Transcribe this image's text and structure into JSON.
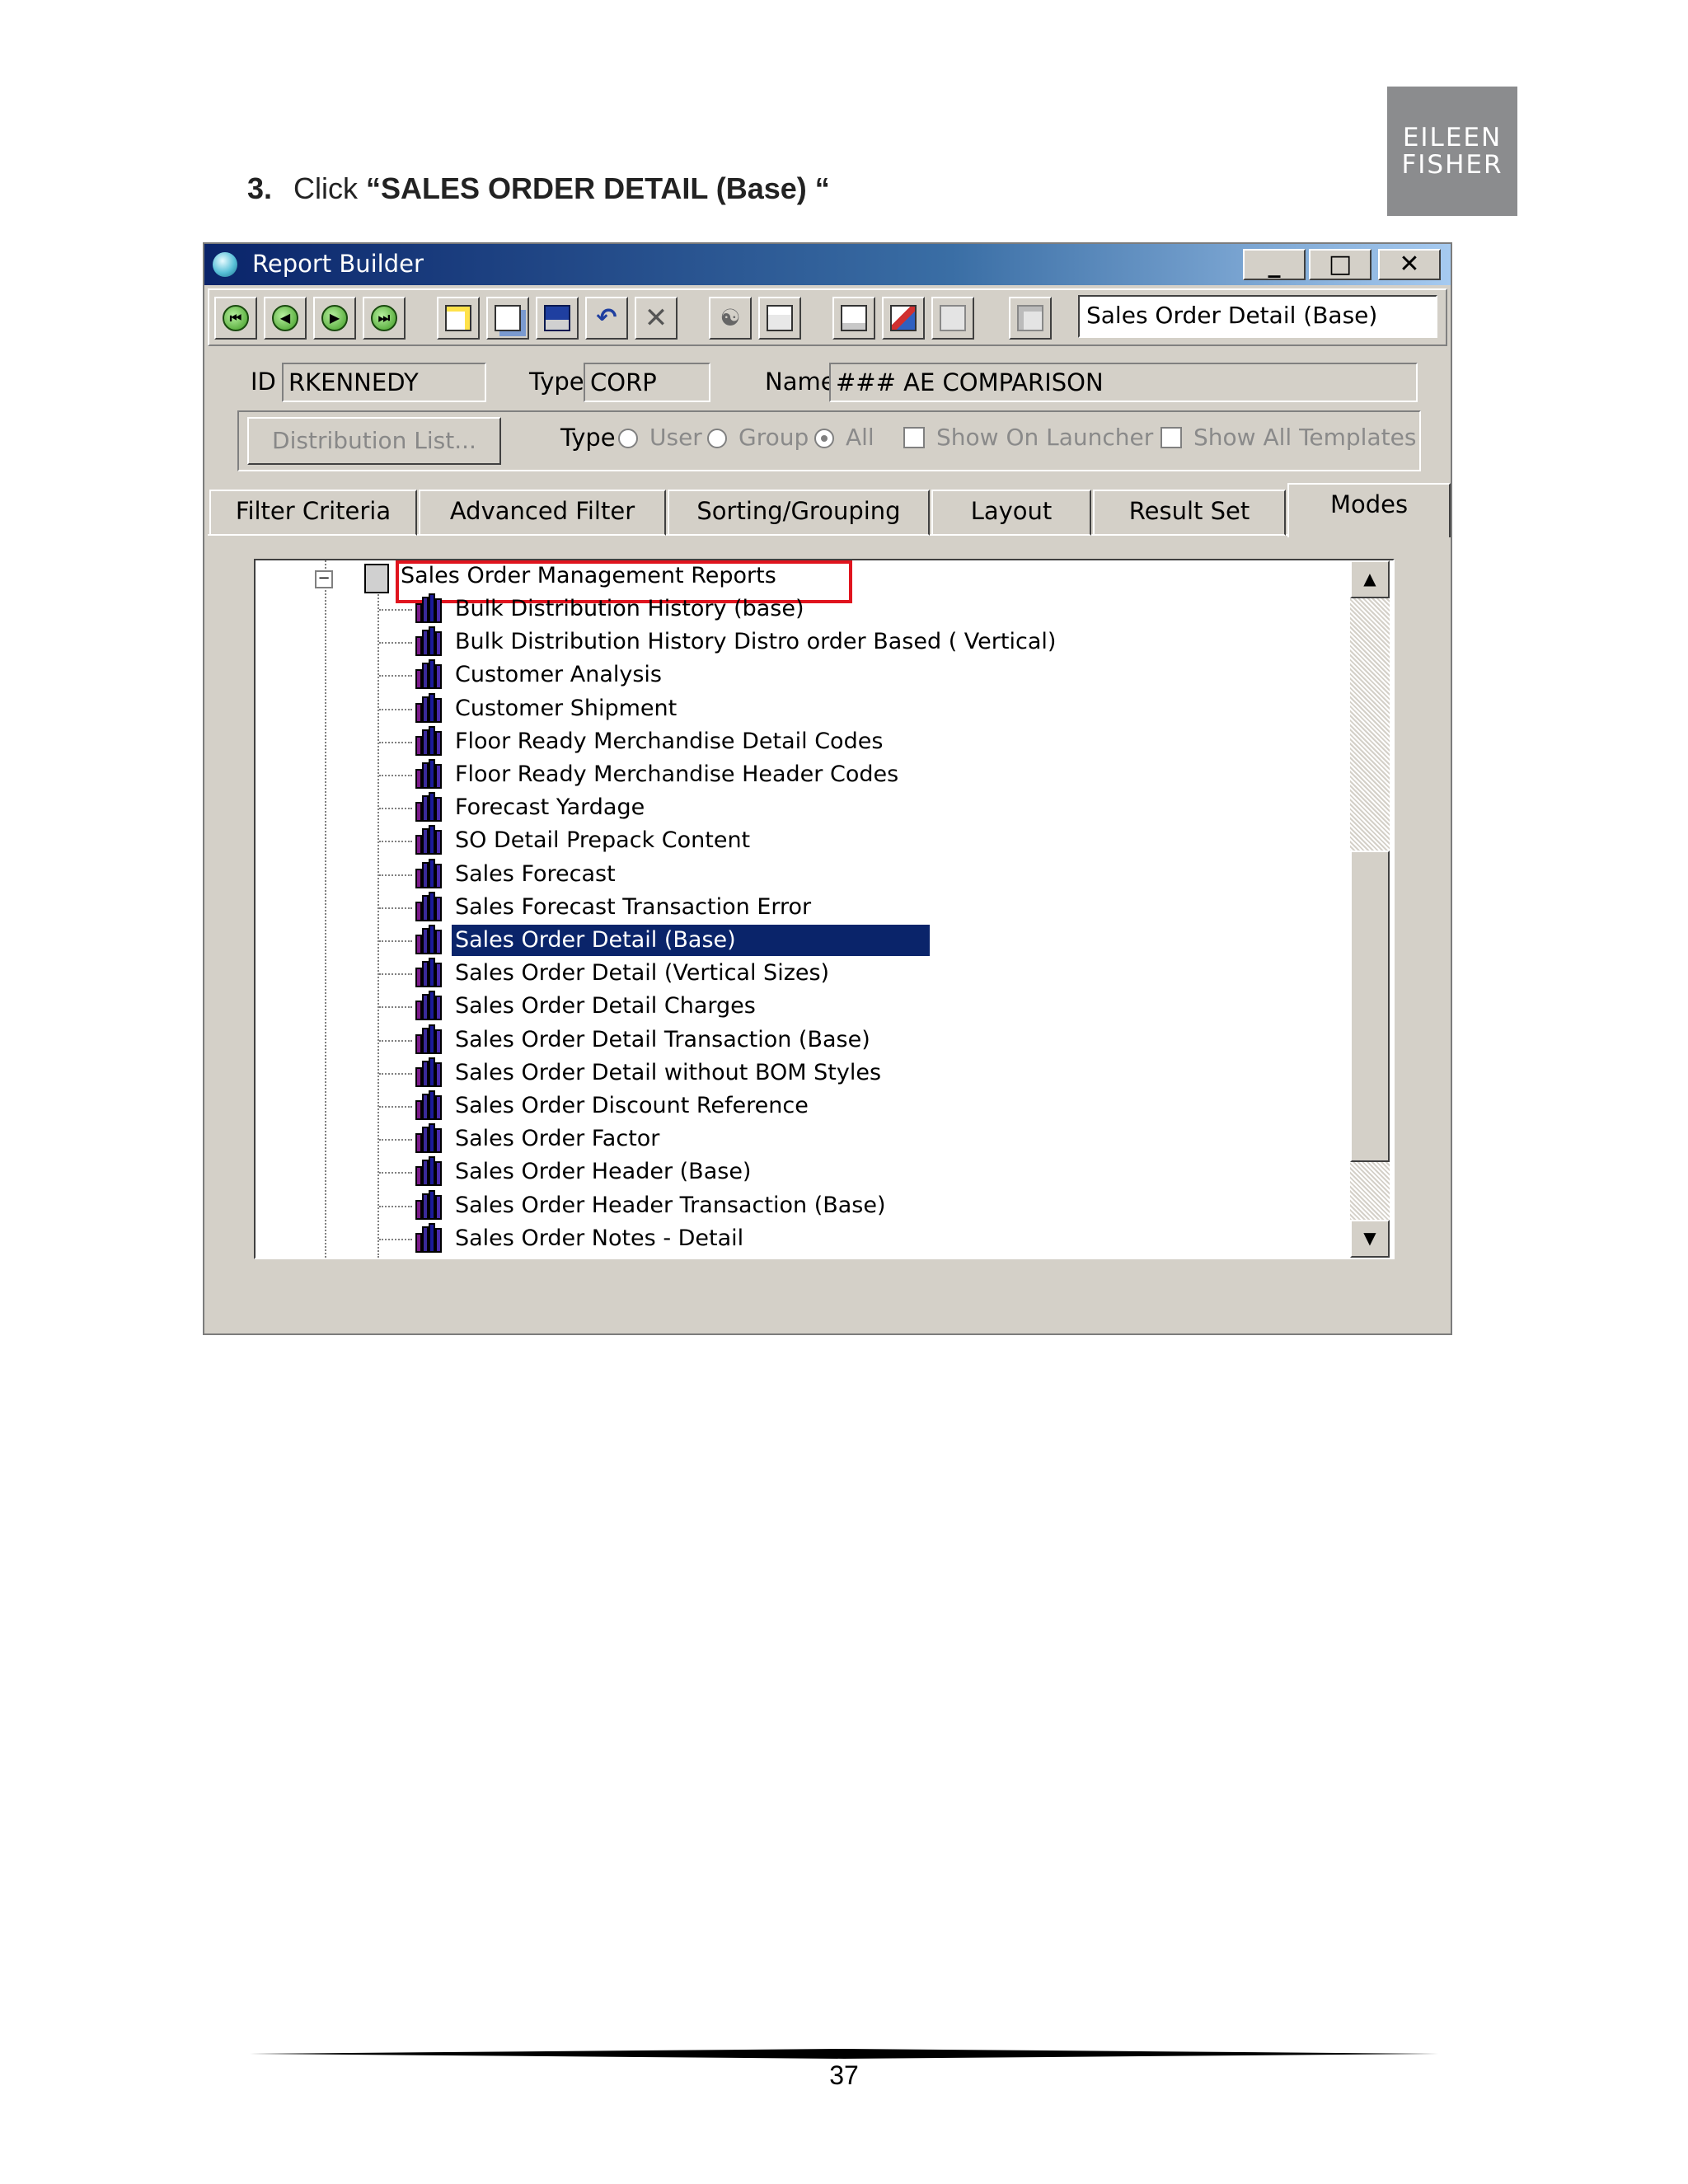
{
  "step": {
    "number": "3.",
    "prefix": "Click ",
    "target": "“SALES ORDER DETAIL (Base) “"
  },
  "logo": {
    "line1": "EILEEN",
    "line2": "FISHER"
  },
  "window": {
    "title": "Report Builder",
    "caption_buttons": [
      "_",
      "□",
      "✕"
    ],
    "report_combo_value": "Sales Order Detail (Base)"
  },
  "toolbar_icons": [
    "first-record-icon",
    "previous-record-icon",
    "next-record-icon",
    "last-record-icon",
    "new-icon",
    "copy-icon",
    "save-icon",
    "undo-icon",
    "delete-icon",
    "find-icon",
    "print-icon",
    "properties-icon",
    "preview-icon",
    "export-icon",
    "layout-icon"
  ],
  "fields": {
    "id_label": "ID",
    "id_value": "RKENNEDY",
    "type_label": "Type",
    "type_value": "CORP",
    "name_label": "Name",
    "name_value": "### AE COMPARISON"
  },
  "options": {
    "distribution_button": "Distribution List...",
    "type_label": "Type",
    "radios": [
      "User",
      "Group",
      "All"
    ],
    "selected_radio": "All",
    "show_on_launcher": "Show On Launcher",
    "show_all_templates": "Show All Templates"
  },
  "tabs": [
    "Filter Criteria",
    "Advanced Filter",
    "Sorting/Grouping",
    "Layout",
    "Result Set",
    "Modes"
  ],
  "active_tab": "Modes",
  "tree": {
    "root": "Sales Order Management Reports",
    "items": [
      "Bulk Distribution History (base)",
      "Bulk Distribution History Distro order Based ( Vertical)",
      "Customer Analysis",
      "Customer Shipment",
      "Floor Ready Merchandise Detail Codes",
      "Floor Ready Merchandise Header Codes",
      "Forecast Yardage",
      "SO Detail Prepack Content",
      "Sales Forecast",
      "Sales Forecast Transaction Error",
      "Sales Order Detail (Base)",
      "Sales Order Detail (Vertical Sizes)",
      "Sales Order Detail Charges",
      "Sales Order Detail Transaction (Base)",
      "Sales Order Detail without BOM Styles",
      "Sales Order Discount Reference",
      "Sales Order Factor",
      "Sales Order Header (Base)",
      "Sales Order Header Transaction (Base)",
      "Sales Order Notes - Detail"
    ],
    "selected": "Sales Order Detail (Base)"
  },
  "page_number": "37",
  "colors": {
    "highlight": "#e0141e",
    "selection": "#0a246a",
    "title_bar": "#0a246a",
    "logo_bg": "#8b8c8e"
  }
}
